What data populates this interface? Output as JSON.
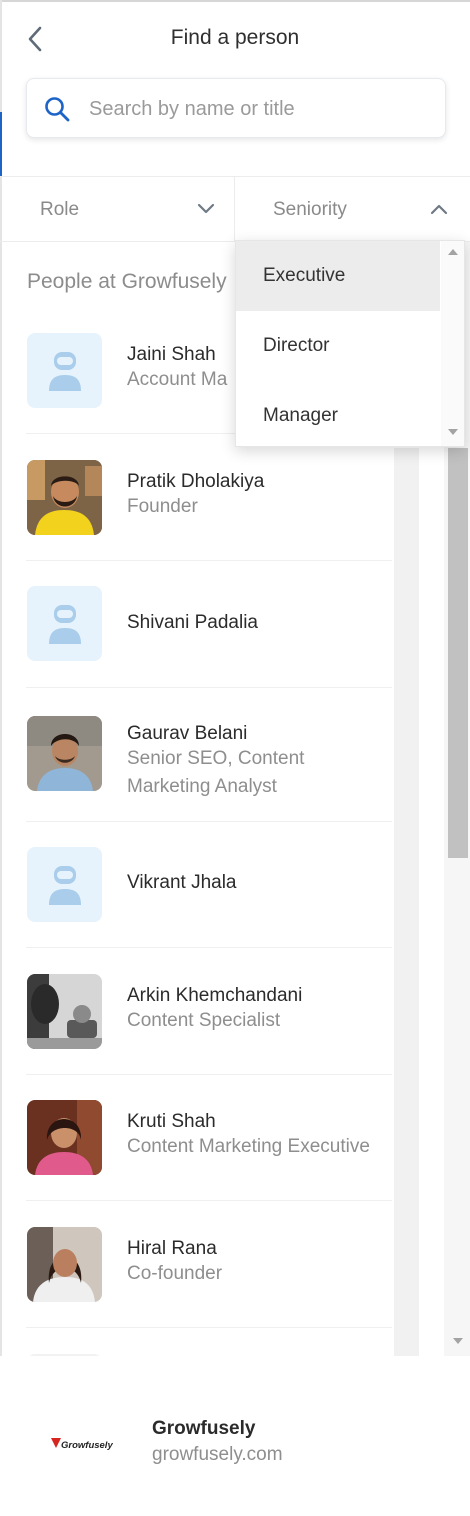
{
  "header": {
    "title": "Find a person"
  },
  "search": {
    "placeholder": "Search by name or title",
    "value": ""
  },
  "filters": {
    "role": {
      "label": "Role"
    },
    "seniority": {
      "label": "Seniority",
      "expanded": true
    }
  },
  "dropdown": {
    "options": [
      {
        "label": "Executive",
        "highlighted": true
      },
      {
        "label": "Director",
        "highlighted": false
      },
      {
        "label": "Manager",
        "highlighted": false
      }
    ]
  },
  "list": {
    "heading": "People at Growfusely",
    "people": [
      {
        "name": "Jaini Shah",
        "title": "Account Ma",
        "avatar": "placeholder-avatar-icon"
      },
      {
        "name": "Pratik Dholakiya",
        "title": "Founder",
        "avatar": "photo"
      },
      {
        "name": "Shivani Padalia",
        "title": "",
        "avatar": "placeholder-avatar-icon"
      },
      {
        "name": "Gaurav Belani",
        "title": "Senior SEO, Content",
        "title_line2": "Marketing Analyst",
        "avatar": "photo"
      },
      {
        "name": "Vikrant Jhala",
        "title": "",
        "avatar": "placeholder-avatar-icon"
      },
      {
        "name": "Arkin Khemchandani",
        "title": "Content Specialist",
        "avatar": "photo"
      },
      {
        "name": "Kruti Shah",
        "title": "Content Marketing Executive",
        "avatar": "photo"
      },
      {
        "name": "Hiral Rana",
        "title": "Co-founder",
        "avatar": "photo"
      }
    ]
  },
  "company": {
    "name": "Growfusely",
    "domain": "growfusely.com",
    "logo_text": "Growfusely"
  },
  "colors": {
    "accent": "#1e63c7",
    "placeholder_bg": "#e6f3fd",
    "placeholder_fg": "#a9cdea",
    "logo_red": "#d6261f"
  }
}
